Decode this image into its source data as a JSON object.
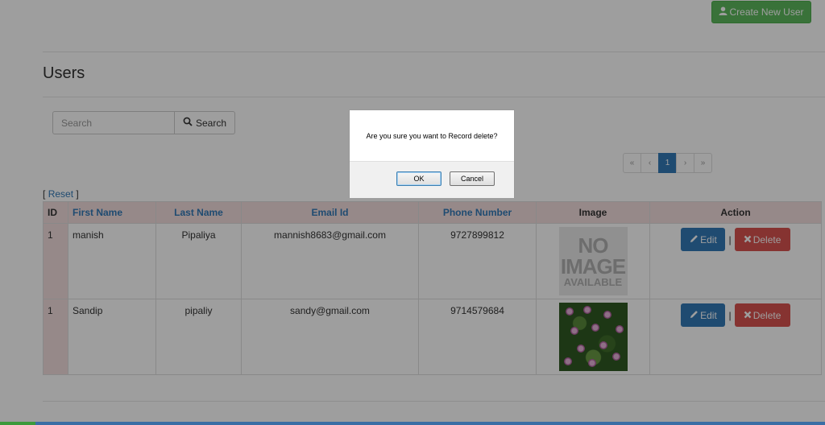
{
  "header": {
    "create_button_label": "Create New User"
  },
  "page": {
    "title": "Users"
  },
  "search": {
    "placeholder": "Search",
    "button_label": "Search"
  },
  "pagination": {
    "first": "«",
    "prev": "‹",
    "current": "1",
    "next": "›",
    "last": "»"
  },
  "reset": {
    "open": "[",
    "label": "Reset",
    "close": "]"
  },
  "table": {
    "headers": [
      "ID",
      "First Name",
      "Last Name",
      "Email Id",
      "Phone Number",
      "Image",
      "Action"
    ],
    "rows": [
      {
        "id": "1",
        "first_name": "manish",
        "last_name": "Pipaliya",
        "email": "mannish8683@gmail.com",
        "phone": "9727899812",
        "image": "no-image"
      },
      {
        "id": "1",
        "first_name": "Sandip",
        "last_name": "pipaliy",
        "email": "sandy@gmail.com",
        "phone": "9714579684",
        "image": "flower-photo"
      }
    ],
    "edit_label": "Edit",
    "delete_label": "Delete",
    "separator": "|",
    "no_image_line1": "NO",
    "no_image_line2": "IMAGE",
    "no_image_line3": "AVAILABLE"
  },
  "dialog": {
    "message": "Are you sure you want to Record delete?",
    "ok_label": "OK",
    "cancel_label": "Cancel"
  },
  "colors": {
    "success": "#5cb85c",
    "primary": "#337ab7",
    "danger": "#d9534f",
    "table_header_bg": "#f2dede"
  }
}
